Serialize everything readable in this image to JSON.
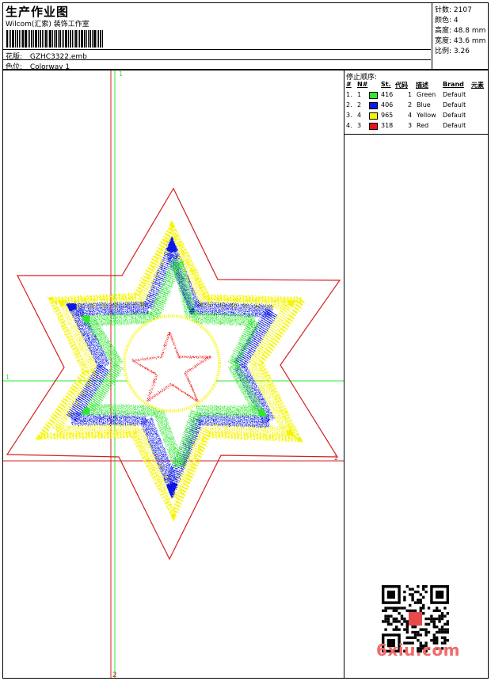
{
  "header": {
    "title": "生产作业图",
    "studio": "Wilcom(汇索) 装饰工作室",
    "design_label": "花版:",
    "design_value": "GZHC3322.emb",
    "colorway_label": "色位:",
    "colorway_value": "Colorway 1"
  },
  "stats": [
    {
      "label": "针数:",
      "value": "2107"
    },
    {
      "label": "颜色:",
      "value": "4"
    },
    {
      "label": "高度:",
      "value": "48.8 mm"
    },
    {
      "label": "宽度:",
      "value": "43.6 mm"
    },
    {
      "label": "比例:",
      "value": "3.26"
    }
  ],
  "legend": {
    "title": "停止顺序:",
    "headers": [
      "#",
      "N#",
      "St.",
      "代码",
      "描述",
      "Brand",
      "元素"
    ],
    "rows": [
      {
        "order": "1.",
        "n": "1",
        "color": "#2ee82e",
        "stitches": "416",
        "code": "1",
        "desc": "Green",
        "brand": "Default"
      },
      {
        "order": "2.",
        "n": "2",
        "color": "#0a18e8",
        "stitches": "406",
        "code": "2",
        "desc": "Blue",
        "brand": "Default"
      },
      {
        "order": "3.",
        "n": "4",
        "color": "#f5f500",
        "stitches": "965",
        "code": "4",
        "desc": "Yellow",
        "brand": "Default"
      },
      {
        "order": "4.",
        "n": "3",
        "color": "#ee1111",
        "stitches": "318",
        "code": "3",
        "desc": "Red",
        "brand": "Default"
      }
    ]
  },
  "design": {
    "axis_marks": {
      "top": "1",
      "left": "1",
      "bottom": "2",
      "right": "2"
    },
    "colors": {
      "green": "#2ee82e",
      "blue": "#0a18e8",
      "yellow": "#f5f500",
      "red": "#ee1111",
      "outline": "#d42020"
    }
  },
  "watermark": "6xiu.com"
}
